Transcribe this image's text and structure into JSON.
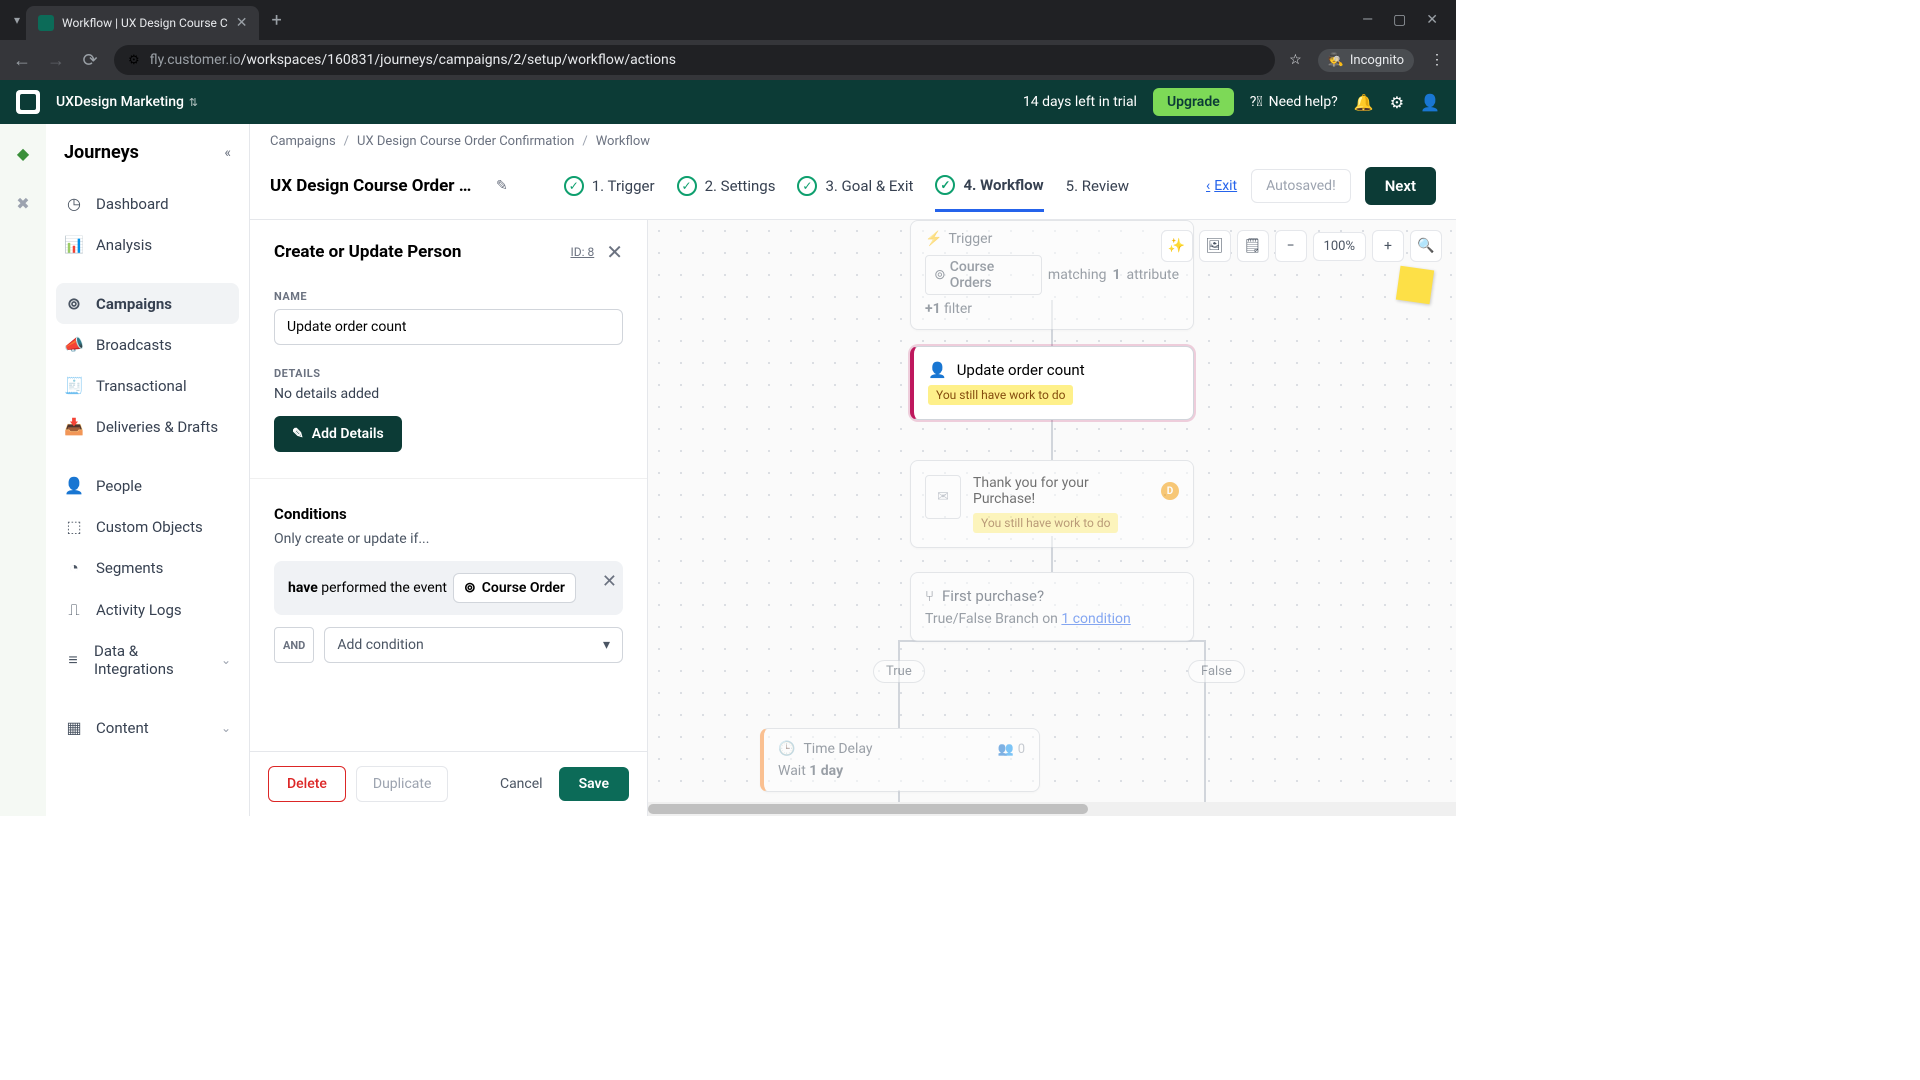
{
  "browser": {
    "tab_title": "Workflow | UX Design Course C",
    "url_host": "fly.customer.io",
    "url_path": "/workspaces/160831/journeys/campaigns/2/setup/workflow/actions",
    "incognito": "Incognito"
  },
  "header": {
    "workspace": "UXDesign Marketing",
    "trial": "14 days left in trial",
    "upgrade": "Upgrade",
    "help": "Need help?"
  },
  "sidebar": {
    "title": "Journeys",
    "items": {
      "dashboard": "Dashboard",
      "analysis": "Analysis",
      "campaigns": "Campaigns",
      "broadcasts": "Broadcasts",
      "transactional": "Transactional",
      "deliveries": "Deliveries & Drafts",
      "people": "People",
      "custom_objects": "Custom Objects",
      "segments": "Segments",
      "activity_logs": "Activity Logs",
      "data_integrations": "Data & Integrations",
      "content": "Content"
    }
  },
  "breadcrumbs": {
    "a": "Campaigns",
    "b": "UX Design Course Order Confirmation",
    "c": "Workflow"
  },
  "campaign": {
    "title": "UX Design Course Order Confir...",
    "steps": {
      "s1": "1. Trigger",
      "s2": "2. Settings",
      "s3": "3. Goal & Exit",
      "s4": "4. Workflow",
      "s5": "5. Review"
    },
    "exit": "Exit",
    "autosaved": "Autosaved!",
    "next": "Next"
  },
  "panel": {
    "title": "Create or Update Person",
    "id": "ID: 8",
    "name_label": "NAME",
    "name_value": "Update order count",
    "details_label": "DETAILS",
    "details_empty": "No details added",
    "add_details": "Add Details",
    "conditions_title": "Conditions",
    "conditions_sub": "Only create or update if...",
    "cond_have": "have",
    "cond_performed": " performed the event",
    "cond_event": "Course Order",
    "and": "AND",
    "add_condition": "Add condition",
    "delete": "Delete",
    "duplicate": "Duplicate",
    "cancel": "Cancel",
    "save": "Save"
  },
  "canvas": {
    "zoom": "100%",
    "trigger": {
      "title": "Trigger",
      "event": "Course Orders",
      "matching": " matching ",
      "count": "1",
      "attribute": " attribute",
      "filter_plus": "+1",
      "filter": " filter"
    },
    "action": {
      "title": "Update order count",
      "badge": "You still have work to do"
    },
    "email": {
      "title": "Thank you for your Purchase!",
      "badge": "You still have work to do"
    },
    "branch": {
      "title": "First purchase?",
      "desc_a": "True/False Branch on ",
      "desc_link": "1 condition",
      "true": "True",
      "false": "False"
    },
    "delay": {
      "title": "Time Delay",
      "count": "0",
      "wait_a": "Wait ",
      "wait_b": "1 day"
    }
  }
}
